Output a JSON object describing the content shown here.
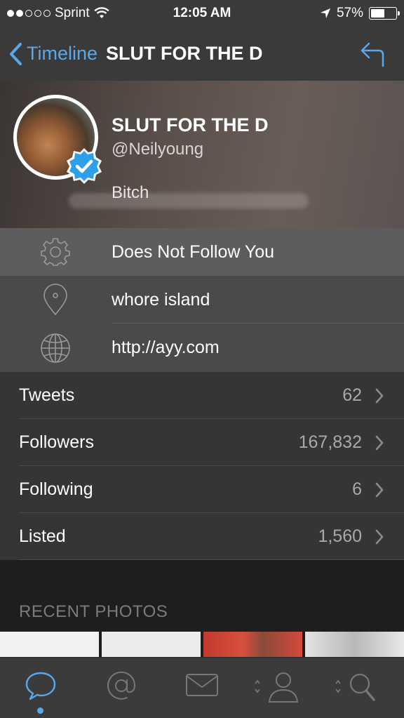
{
  "status_bar": {
    "carrier": "Sprint",
    "time": "12:05 AM",
    "battery": "57%",
    "battery_level": 0.57
  },
  "nav": {
    "back_label": "Timeline",
    "title": "SLUT FOR THE D"
  },
  "profile": {
    "name": "SLUT FOR THE D",
    "handle": "@Neilyoung",
    "bio": "Bitch"
  },
  "info": {
    "follow_status": "Does Not Follow You",
    "location": "whore island",
    "url": "http://ayy.com"
  },
  "stats": [
    {
      "label": "Tweets",
      "value": "62"
    },
    {
      "label": "Followers",
      "value": "167,832"
    },
    {
      "label": "Following",
      "value": "6"
    },
    {
      "label": "Listed",
      "value": "1,560"
    }
  ],
  "recent_photos_label": "RECENT PHOTOS",
  "colors": {
    "accent": "#5aa8ea",
    "bar": "#3a3a3a"
  }
}
